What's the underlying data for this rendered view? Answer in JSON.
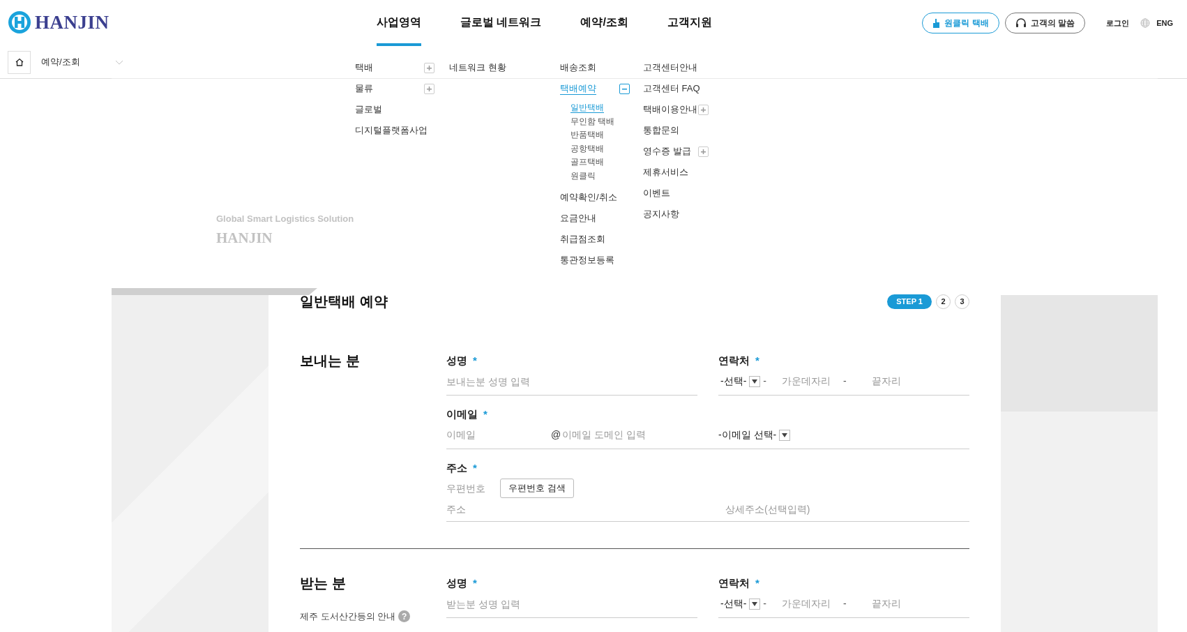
{
  "logo": {
    "text": "HANJIN"
  },
  "nav": [
    {
      "label": "사업영역",
      "selected": true
    },
    {
      "label": "글로벌 네트워크",
      "selected": false
    },
    {
      "label": "예약/조회",
      "selected": false
    },
    {
      "label": "고객지원",
      "selected": false
    }
  ],
  "header_buttons": [
    {
      "label": "원클릭 택배",
      "kind": "primary"
    },
    {
      "label": "고객의 말씀",
      "kind": "outline"
    }
  ],
  "login": "로그인",
  "language": "ENG",
  "breadcrumb": {
    "current": "예약/조회"
  },
  "mega_menu": {
    "columns": [
      {
        "items": [
          {
            "label": "택배",
            "selected": false,
            "expanded": false
          },
          {
            "label": "물류",
            "selected": false,
            "expanded": false
          },
          {
            "label": "글로벌",
            "selected": false
          },
          {
            "label": "디지털플랫폼사업",
            "selected": false
          }
        ]
      },
      {
        "items": [
          {
            "label": "네트워크 현황",
            "selected": false
          }
        ]
      },
      {
        "items": [
          {
            "label": "배송조회",
            "selected": false
          },
          {
            "label": "택배예약",
            "selected": true,
            "expanded": true,
            "children": [
              {
                "label": "일반택배",
                "selected": true
              },
              {
                "label": "무인함 택배",
                "selected": false
              },
              {
                "label": "반품택배",
                "selected": false
              },
              {
                "label": "공항택배",
                "selected": false
              },
              {
                "label": "골프택배",
                "selected": false
              },
              {
                "label": "원클릭",
                "selected": false
              }
            ]
          },
          {
            "label": "예약확인/취소",
            "selected": false
          },
          {
            "label": "요금안내",
            "selected": false
          },
          {
            "label": "취급점조회",
            "selected": false
          },
          {
            "label": "통관정보등록",
            "selected": false
          }
        ]
      },
      {
        "items": [
          {
            "label": "고객센터안내",
            "selected": false
          },
          {
            "label": "고객센터 FAQ",
            "selected": false
          },
          {
            "label": "택배이용안내",
            "selected": false,
            "expanded": false
          },
          {
            "label": "통합문의",
            "selected": false
          },
          {
            "label": "영수증 발급",
            "selected": false,
            "expanded": false
          },
          {
            "label": "제휴서비스",
            "selected": false
          },
          {
            "label": "이벤트",
            "selected": false
          },
          {
            "label": "공지사항",
            "selected": false
          }
        ]
      }
    ]
  },
  "hero": {
    "tagline": "Global Smart Logistics Solution",
    "brand": "HANJIN"
  },
  "page_title": "일반택배 예약",
  "steps": [
    {
      "label": "STEP 1",
      "selected": true
    },
    {
      "label": "2",
      "selected": false
    },
    {
      "label": "3",
      "selected": false
    }
  ],
  "required_mark": "*",
  "sender": {
    "heading": "보내는 분",
    "rows": [
      [
        {
          "kind": "text",
          "label": "성명",
          "required": true,
          "placeholder": "보내는분 성명 입력"
        },
        {
          "kind": "phone",
          "label": "연락처",
          "required": true,
          "select": "-선택-",
          "separators": [
            "-",
            "-"
          ],
          "middle_placeholder": "가운데자리",
          "last_placeholder": "끝자리"
        }
      ],
      [
        {
          "kind": "email",
          "label": "이메일",
          "required": true,
          "placeholder": "이메일",
          "at": "@",
          "domain_placeholder": "이메일 도메인 입력",
          "select": "-이메일 선택-"
        }
      ],
      [
        {
          "kind": "address",
          "label": "주소",
          "required": true,
          "zip_placeholder": "우편번호",
          "search_button": "우편번호 검색",
          "address_placeholder": "주소",
          "detail_placeholder": "상세주소(선택입력)"
        }
      ]
    ]
  },
  "receiver": {
    "heading": "받는 분",
    "note": "제주 도서산간등의 안내",
    "help": "?",
    "rows": [
      [
        {
          "kind": "text",
          "label": "성명",
          "required": true,
          "placeholder": "받는분 성명 입력"
        },
        {
          "kind": "phone",
          "label": "연락처",
          "required": true,
          "select": "-선택-",
          "separators": [
            "-",
            "-"
          ],
          "middle_placeholder": "가운데자리",
          "last_placeholder": "끝자리"
        }
      ]
    ]
  }
}
